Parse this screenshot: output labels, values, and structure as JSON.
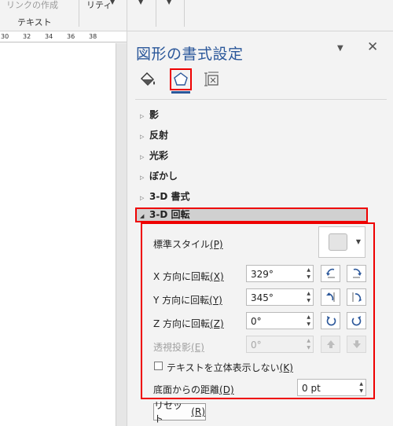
{
  "ribbon": {
    "link_item": "リンクの作成",
    "item2": "リティ",
    "group_label": "テキスト"
  },
  "ruler": {
    "ticks": [
      "30",
      "32",
      "34",
      "36",
      "38"
    ]
  },
  "pane": {
    "title": "図形の書式設定",
    "tabs": [
      "fill-line",
      "effects",
      "layout-properties"
    ],
    "sections": [
      "影",
      "反射",
      "光彩",
      "ぼかし",
      "3-D 書式"
    ],
    "active_section": "3-D 回転",
    "preset_label": "標準スタイル",
    "preset_key": "(P)",
    "x_label": "X 方向に回転",
    "x_key": "(X)",
    "x_value": "329°",
    "y_label": "Y 方向に回転",
    "y_key": "(Y)",
    "y_value": "345°",
    "z_label": "Z 方向に回転",
    "z_key": "(Z)",
    "z_value": "0°",
    "persp_label": "透視投影",
    "persp_key": "(E)",
    "persp_value": "0°",
    "keep_flat_label": "テキストを立体表示しない",
    "keep_flat_key": "(K)",
    "keep_flat_checked": false,
    "distance_label": "底面からの距離",
    "distance_key": "(D)",
    "distance_value": "0 pt",
    "reset_label": "リセット",
    "reset_key": "(R)"
  },
  "colors": {
    "accent": "#2b579a",
    "highlight": "#e00000",
    "pane_bg": "#f3f3f3"
  }
}
